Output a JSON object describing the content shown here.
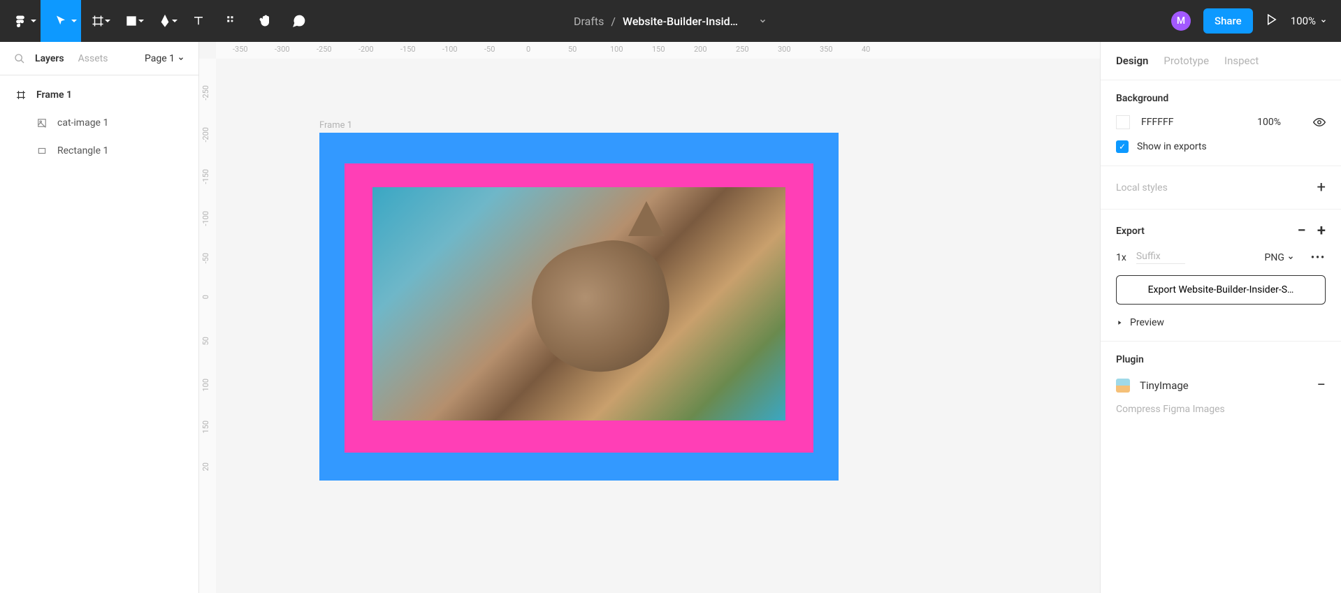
{
  "toolbar": {
    "folder": "Drafts",
    "filename": "Website-Builder-Insid…",
    "avatar_initial": "M",
    "share_label": "Share",
    "zoom": "100%"
  },
  "left": {
    "tabs": {
      "layers": "Layers",
      "assets": "Assets"
    },
    "page": "Page 1",
    "layers": [
      {
        "name": "Frame 1",
        "icon": "frame"
      },
      {
        "name": "cat-image 1",
        "icon": "image"
      },
      {
        "name": "Rectangle 1",
        "icon": "rect"
      }
    ]
  },
  "canvas": {
    "frame_label": "Frame 1",
    "ruler_h": [
      "-350",
      "-300",
      "-250",
      "-200",
      "-150",
      "-100",
      "-50",
      "0",
      "50",
      "100",
      "150",
      "200",
      "250",
      "300",
      "350",
      "40"
    ],
    "ruler_v": [
      "-250",
      "-200",
      "-150",
      "-100",
      "-50",
      "0",
      "50",
      "100",
      "150",
      "20"
    ]
  },
  "right": {
    "tabs": {
      "design": "Design",
      "prototype": "Prototype",
      "inspect": "Inspect"
    },
    "background": {
      "title": "Background",
      "hex": "FFFFFF",
      "opacity": "100%",
      "show_exports": "Show in exports"
    },
    "local_styles": "Local styles",
    "export": {
      "title": "Export",
      "scale": "1x",
      "suffix_placeholder": "Suffix",
      "format": "PNG",
      "button": "Export Website-Builder-Insider-S…",
      "preview": "Preview"
    },
    "plugin": {
      "title": "Plugin",
      "name": "TinyImage",
      "desc": "Compress Figma Images"
    }
  }
}
